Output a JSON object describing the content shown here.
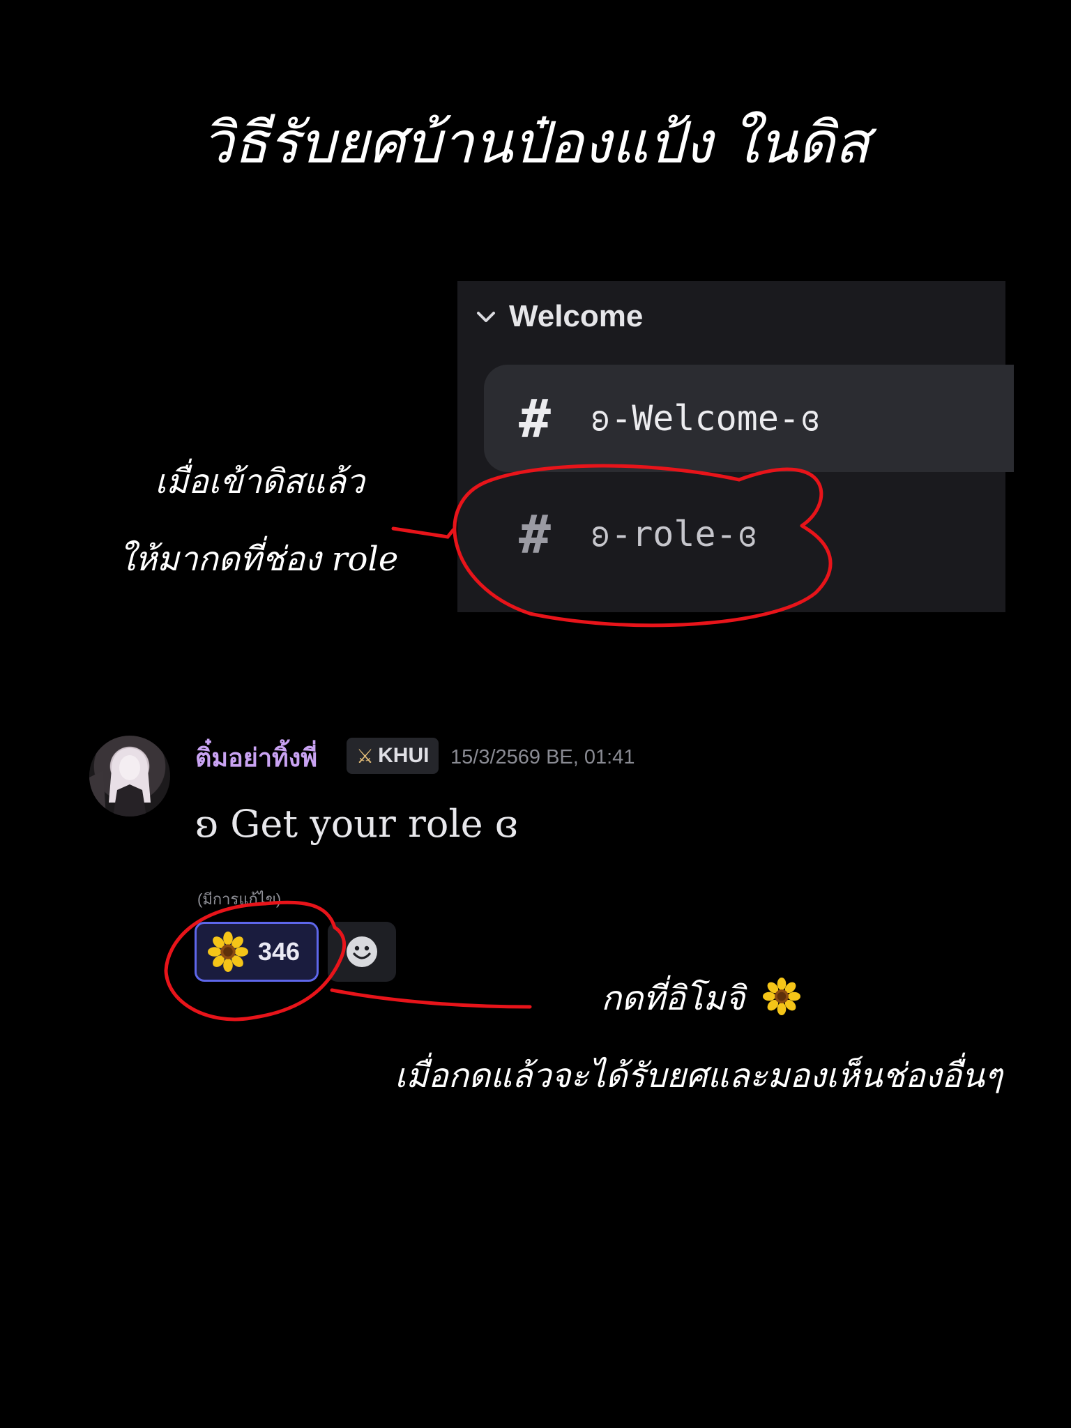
{
  "title": "วิธีรับยศบ้านป๋องแป้ง ในดิส",
  "notes": {
    "step1_line1": "เมื่อเข้าดิสแล้ว",
    "step1_line2": "ให้มากดที่ช่อง role",
    "step2_line1": "กดที่อิโมจิ",
    "step2_emoji_icon": "sunflower-emoji",
    "step2_line2": "เมื่อกดแล้วจะได้รับยศและมองเห็นช่องอื่นๆ"
  },
  "sidebar": {
    "category_label": "Welcome",
    "channels": [
      {
        "hash": "#",
        "name": "ʚ-Welcome-ɞ",
        "active": true
      },
      {
        "hash": "#",
        "name": "ʚ-role-ɞ",
        "active": false
      }
    ]
  },
  "message": {
    "username": "ติ๋มอย่าทิ้งพี่",
    "tag_icon": "⚔",
    "tag": "KHUI",
    "timestamp": "15/3/2569 BE, 01:41",
    "content": "ʚ Get your role ɞ",
    "edited": "(มีการแก้ไข)",
    "reaction": {
      "emoji_icon": "sunflower-emoji",
      "count": "346"
    },
    "add_reaction_icon": "smiley-icon"
  },
  "colors": {
    "background": "#000000",
    "annotation": "#e8141a",
    "username": "#c9a3f2",
    "reaction_border": "#5e67ea"
  }
}
